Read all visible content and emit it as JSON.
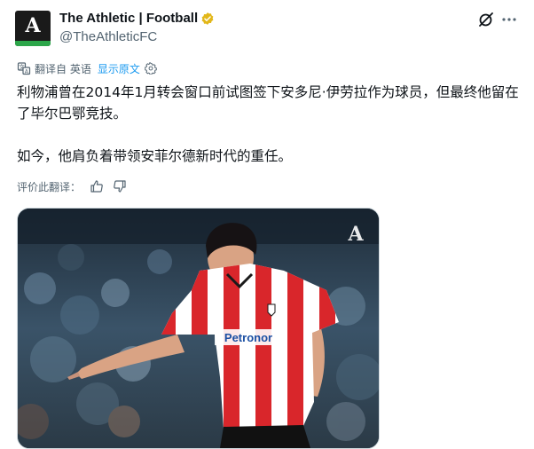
{
  "account": {
    "avatar_letter": "A",
    "name": "The Athletic | Football",
    "handle": "@TheAthleticFC",
    "badge_color": "#e2b719",
    "avatar_accent": "#2ca64a"
  },
  "icons": {
    "badge": "verified-gold-badge-icon",
    "grok": "grok-icon",
    "more": "more-options-icon",
    "translate": "translate-icon",
    "settings": "gear-icon",
    "like": "thumbs-up-icon",
    "dislike": "thumbs-down-icon"
  },
  "translation": {
    "translated_from": "翻译自 英语",
    "show_original": "显示原文"
  },
  "tweet": {
    "paragraph1": "利物浦曾在2014年1月转会窗口前试图签下安多尼·伊劳拉作为球员，但最终他留在了毕尔巴鄂竞技。",
    "paragraph2": "如今，他肩负着带领安菲尔德新时代的重任。"
  },
  "rating": {
    "prompt": "评价此翻译："
  },
  "media": {
    "watermark": "A",
    "sponsor": "Petronor",
    "kit_colors": [
      "#d9262b",
      "#ffffff"
    ]
  }
}
